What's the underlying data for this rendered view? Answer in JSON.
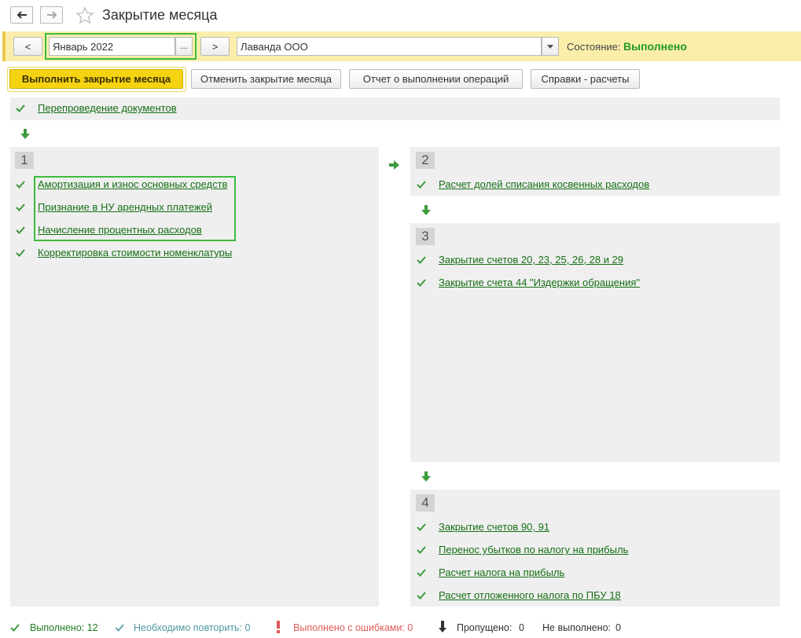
{
  "window": {
    "title": "Закрытие месяца"
  },
  "period": {
    "prev_label": "<",
    "value": "Январь 2022",
    "select_label": "...",
    "next_label": ">",
    "organization": "Лаванда ООО",
    "state_label": "Состояние:",
    "state_value": "Выполнено"
  },
  "toolbar": {
    "execute": "Выполнить закрытие месяца",
    "cancel": "Отменить закрытие месяца",
    "report": "Отчет о выполнении операций",
    "references": "Справки - расчеты"
  },
  "pre": {
    "label": "Перепроведение документов"
  },
  "steps": [
    {
      "number": "1",
      "items": [
        "Амортизация и износ основных средств",
        "Признание в НУ арендных платежей",
        "Начисление процентных расходов",
        "Корректировка стоимости номенклатуры"
      ]
    },
    {
      "number": "2",
      "items": [
        "Расчет долей списания косвенных расходов"
      ]
    },
    {
      "number": "3",
      "items": [
        "Закрытие счетов 20, 23, 25, 26, 28 и 29",
        "Закрытие счета 44 \"Издержки обращения\""
      ]
    },
    {
      "number": "4",
      "items": [
        "Закрытие счетов 90, 91",
        "Перенос убытков по налогу на прибыль",
        "Расчет налога на прибыль",
        "Расчет отложенного налога по ПБУ 18"
      ]
    }
  ],
  "statusbar": {
    "done": "Выполнено: 12",
    "repeat": "Необходимо повторить: 0",
    "errors": "Выполнено с ошибками: 0",
    "skipped_label": "Пропущено:",
    "skipped_value": "0",
    "notdone_label": "Не выполнено:",
    "notdone_value": "0"
  },
  "colors": {
    "accent_green": "#1f9a1f",
    "link_green": "#156f15",
    "execute_yellow": "#f5d312",
    "period_bar": "#fbeeab",
    "error_red": "#e05a5a",
    "repeat_teal": "#4d9aa0"
  }
}
